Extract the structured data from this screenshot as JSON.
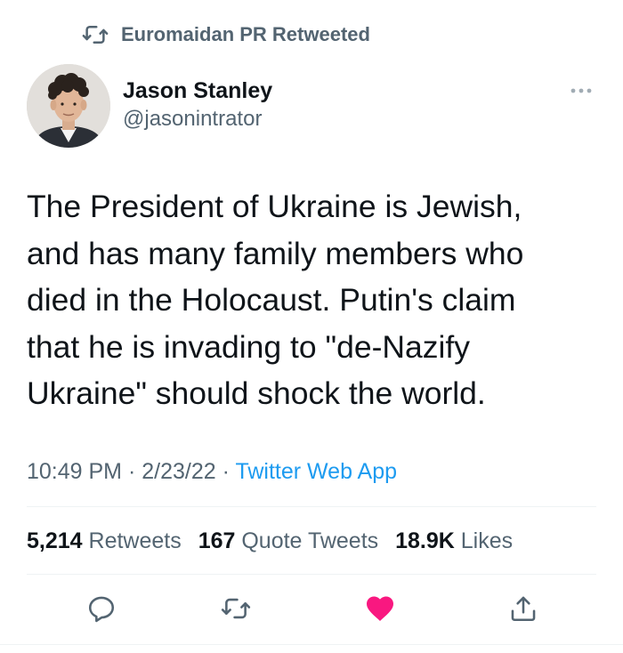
{
  "retweet_context": {
    "icon": "retweet-icon",
    "label": "Euromaidan PR Retweeted"
  },
  "author": {
    "name": "Jason Stanley",
    "handle": "@jasonintrator",
    "avatar": "avatar-photo"
  },
  "more_icon": "more-dots-icon",
  "tweet": {
    "text": "The President of Ukraine is Jewish,\nand has many family members who\ndied in the Holocaust. Putin's claim\nthat he is invading to \"de-Nazify\nUkraine\" should shock the world.",
    "time": "10:49 PM",
    "separator": "·",
    "date": "2/23/22",
    "source": "Twitter Web App"
  },
  "stats": {
    "retweets_count": "5,214",
    "retweets_label": "Retweets",
    "quotes_count": "167",
    "quotes_label": "Quote Tweets",
    "likes_count": "18.9K",
    "likes_label": "Likes"
  },
  "actions": {
    "reply_icon": "reply-icon",
    "retweet_icon": "retweet-icon",
    "like_icon": "heart-icon",
    "share_icon": "share-icon"
  },
  "colors": {
    "text": "#0f1419",
    "secondary": "#536471",
    "link": "#1d9bf0",
    "like": "#f91880",
    "divider": "#eff3f4"
  }
}
